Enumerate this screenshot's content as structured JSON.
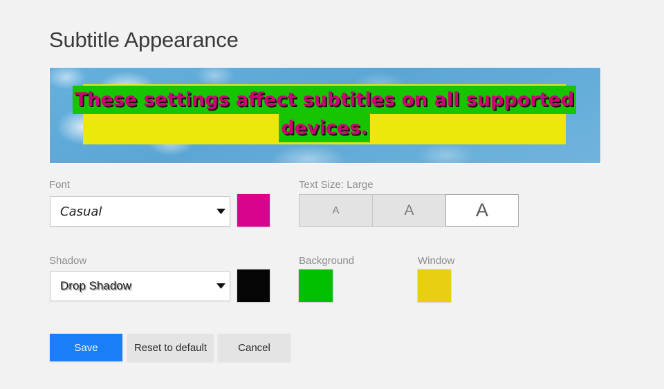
{
  "page": {
    "title": "Subtitle Appearance",
    "background_color": "#f2f2f2"
  },
  "preview": {
    "caption_lines": [
      "These settings affect subtitles on all supported",
      "devices."
    ],
    "full_text": "These settings affect subtitles on all supported devices.",
    "text_color": "#cc0077",
    "background_color": "#17c400",
    "window_color": "#ece80c",
    "shadow_color": "#000000",
    "scene": "sky-with-clouds"
  },
  "font_field": {
    "label": "Font",
    "value": "Casual",
    "caret_icon": "chevron-down-icon",
    "color_swatch": "#d8048c"
  },
  "text_size": {
    "label": "Text Size: Large",
    "value": "Large",
    "options": [
      {
        "label": "A",
        "size": "Small",
        "selected": false
      },
      {
        "label": "A",
        "size": "Medium",
        "selected": false
      },
      {
        "label": "A",
        "size": "Large",
        "selected": true
      }
    ]
  },
  "shadow_field": {
    "label": "Shadow",
    "value": "Drop Shadow",
    "caret_icon": "chevron-down-icon",
    "color_swatch": "#050505"
  },
  "background_field": {
    "label": "Background",
    "color_swatch": "#00c000"
  },
  "window_field": {
    "label": "Window",
    "color_swatch": "#e8cf12"
  },
  "actions": {
    "save": "Save",
    "reset": "Reset to default",
    "cancel": "Cancel",
    "primary_color": "#1a7ef7"
  }
}
